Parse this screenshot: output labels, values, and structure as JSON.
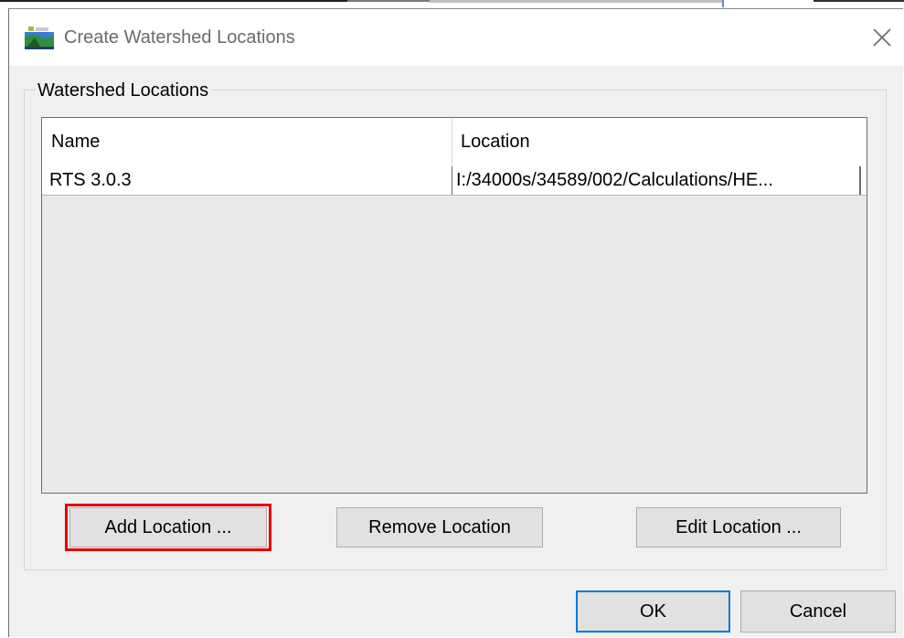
{
  "window": {
    "title": "Create Watershed Locations",
    "icon": "watershed-app-icon",
    "close_icon": "close-icon"
  },
  "group": {
    "label": "Watershed Locations"
  },
  "table": {
    "columns": [
      "Name",
      "Location"
    ],
    "rows": [
      {
        "name": "RTS 3.0.3",
        "location": "I:/34000s/34589/002/Calculations/HE..."
      }
    ]
  },
  "buttons": {
    "add": "Add Location ...",
    "remove": "Remove Location",
    "edit": "Edit Location ...",
    "ok": "OK",
    "cancel": "Cancel"
  },
  "colors": {
    "highlight": "#e00000",
    "default_button_border": "#0078d7",
    "dialog_bg": "#f0f0f0"
  }
}
